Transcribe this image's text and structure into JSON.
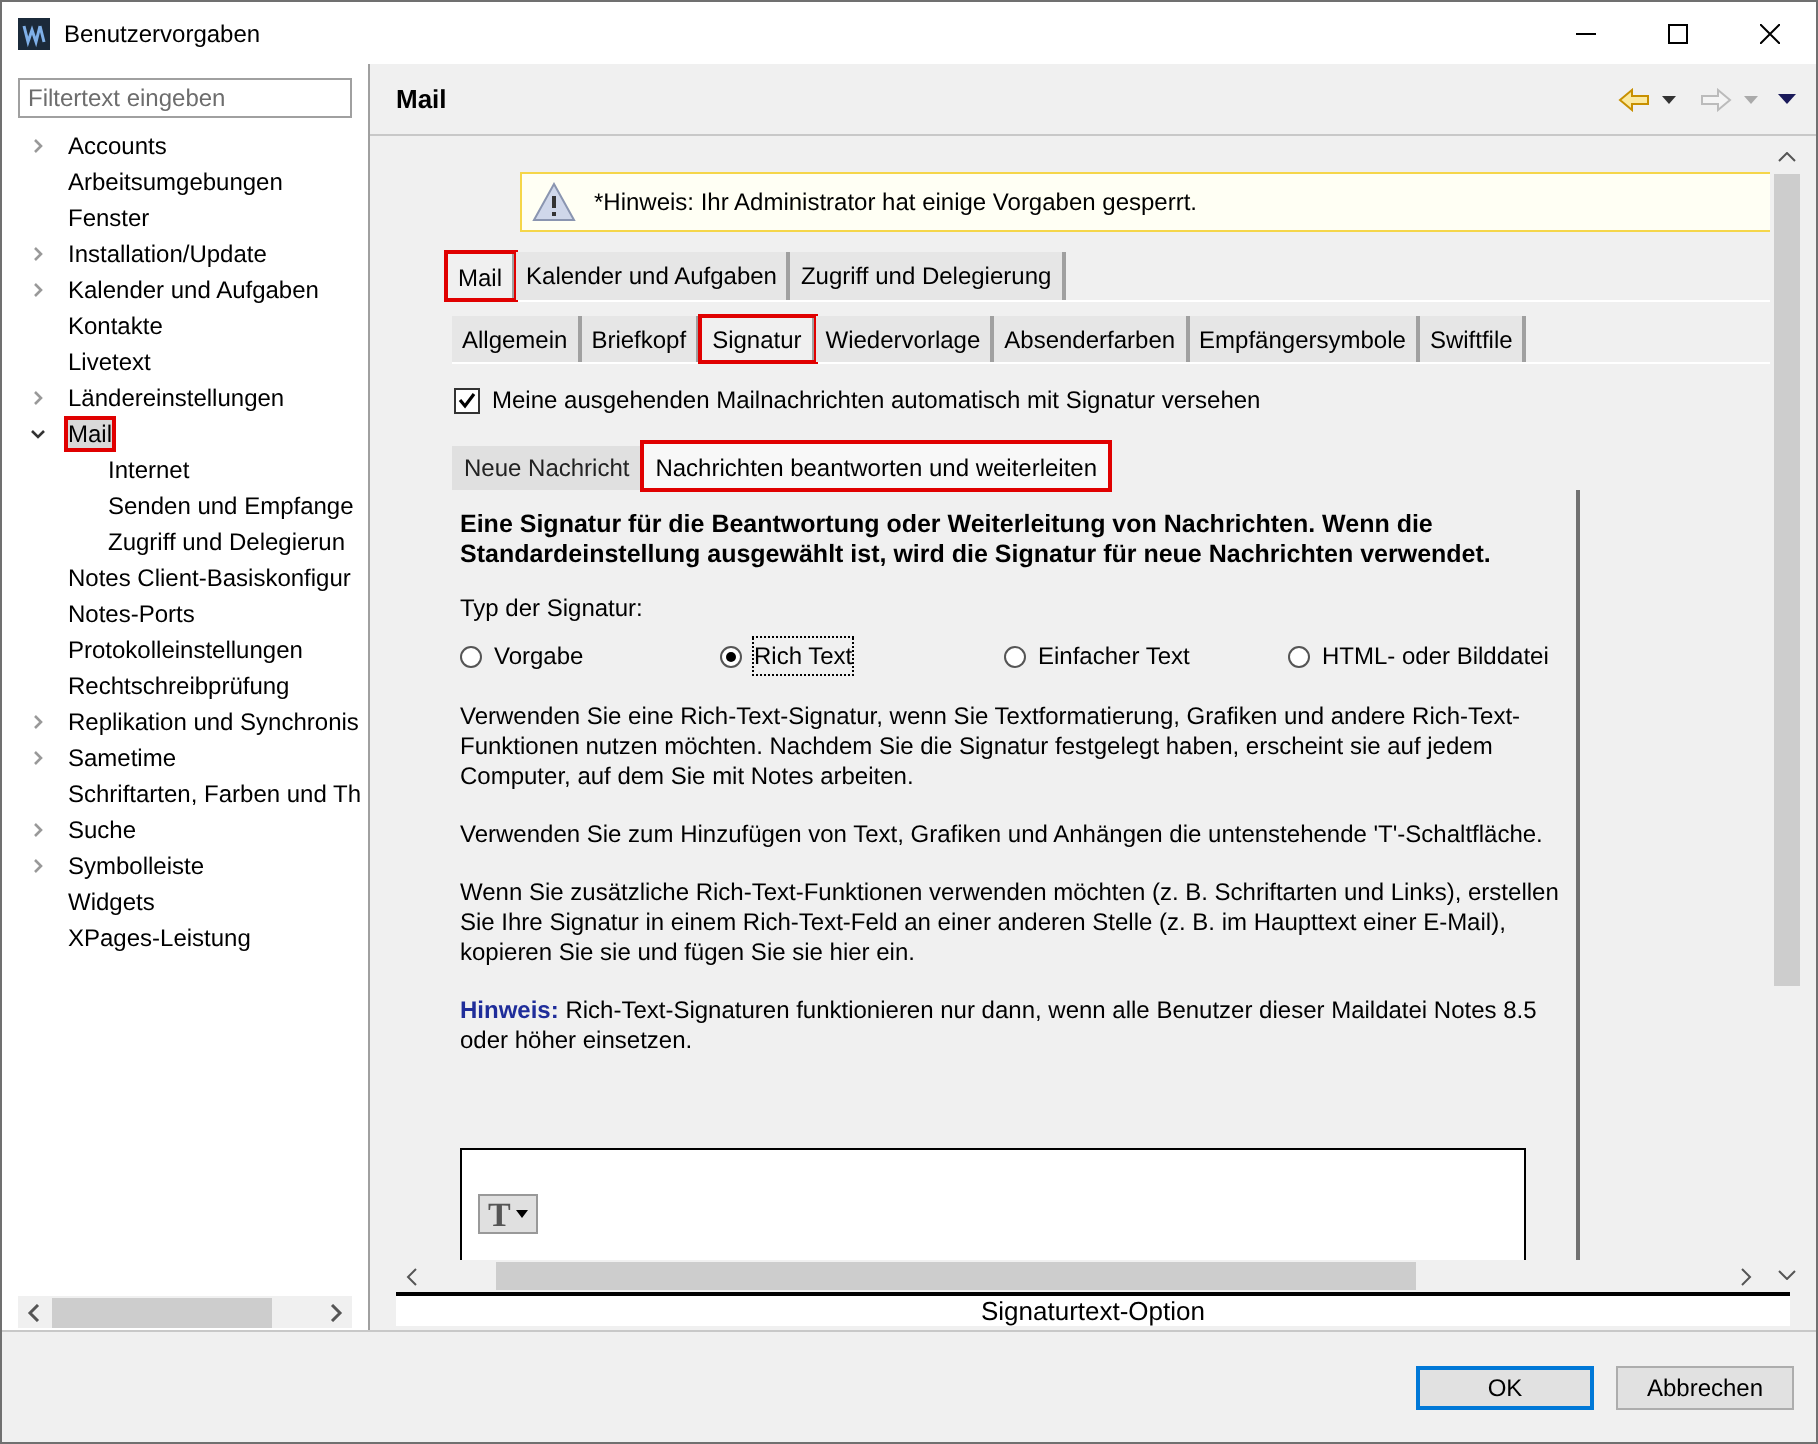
{
  "window": {
    "title": "Benutzervorgaben"
  },
  "filter": {
    "placeholder": "Filtertext eingeben"
  },
  "tree": [
    {
      "label": "Accounts",
      "expanded": false,
      "selected": false,
      "annotated": false
    },
    {
      "label": "Arbeitsumgebungen",
      "selected": false,
      "annotated": false
    },
    {
      "label": "Fenster",
      "selected": false,
      "annotated": false
    },
    {
      "label": "Installation/Update",
      "expanded": false,
      "selected": false,
      "annotated": false
    },
    {
      "label": "Kalender und Aufgaben",
      "expanded": false,
      "selected": false,
      "annotated": false
    },
    {
      "label": "Kontakte",
      "selected": false,
      "annotated": false
    },
    {
      "label": "Livetext",
      "selected": false,
      "annotated": false
    },
    {
      "label": "Ländereinstellungen",
      "expanded": false,
      "selected": false,
      "annotated": false
    },
    {
      "label": "Mail",
      "expanded": true,
      "selected": true,
      "annotated": true,
      "children": [
        {
          "label": "Internet",
          "selected": false,
          "annotated": false
        },
        {
          "label": "Senden und Empfange",
          "selected": false,
          "annotated": false
        },
        {
          "label": "Zugriff und Delegierun",
          "selected": false,
          "annotated": false
        }
      ]
    },
    {
      "label": "Notes Client-Basiskonfigur",
      "selected": false,
      "annotated": false
    },
    {
      "label": "Notes-Ports",
      "selected": false,
      "annotated": false
    },
    {
      "label": "Protokolleinstellungen",
      "selected": false,
      "annotated": false
    },
    {
      "label": "Rechtschreibprüfung",
      "selected": false,
      "annotated": false
    },
    {
      "label": "Replikation und Synchronis",
      "expanded": false,
      "selected": false,
      "annotated": false
    },
    {
      "label": "Sametime",
      "expanded": false,
      "selected": false,
      "annotated": false
    },
    {
      "label": "Schriftarten, Farben und Th",
      "selected": false,
      "annotated": false
    },
    {
      "label": "Suche",
      "expanded": false,
      "selected": false,
      "annotated": false
    },
    {
      "label": "Symbolleiste",
      "expanded": false,
      "selected": false,
      "annotated": false
    },
    {
      "label": "Widgets",
      "selected": false,
      "annotated": false
    },
    {
      "label": "XPages-Leistung",
      "selected": false,
      "annotated": false
    }
  ],
  "page": {
    "title": "Mail",
    "notice": "*Hinweis: Ihr Administrator hat einige Vorgaben gesperrt.",
    "tabs": [
      {
        "label": "Mail",
        "selected": true,
        "annotated": true
      },
      {
        "label": "Kalender und Aufgaben",
        "selected": false,
        "annotated": false
      },
      {
        "label": "Zugriff und Delegierung",
        "selected": false,
        "annotated": false
      }
    ],
    "subtabs": [
      {
        "label": "Allgemein",
        "selected": false,
        "annotated": false
      },
      {
        "label": "Briefkopf",
        "selected": false,
        "annotated": false
      },
      {
        "label": "Signatur",
        "selected": true,
        "annotated": true
      },
      {
        "label": "Wiedervorlage",
        "selected": false,
        "annotated": false
      },
      {
        "label": "Absenderfarben",
        "selected": false,
        "annotated": false
      },
      {
        "label": "Empfängersymbole",
        "selected": false,
        "annotated": false
      },
      {
        "label": "Swiftfile",
        "selected": false,
        "annotated": false
      }
    ],
    "auto_signature": {
      "label": "Meine ausgehenden Mailnachrichten automatisch mit Signatur versehen",
      "checked": true
    },
    "inner_tabs": [
      {
        "label": "Neue Nachricht",
        "selected": false,
        "annotated": false
      },
      {
        "label": "Nachrichten beantworten und weiterleiten",
        "selected": true,
        "annotated": true
      }
    ],
    "heading": "Eine Signatur für die Beantwortung oder Weiterleitung von Nachrichten. Wenn die Standardeinstellung ausgewählt ist, wird die Signatur für neue Nachrichten verwendet.",
    "type_label": "Typ der Signatur:",
    "types": [
      {
        "label": "Vorgabe",
        "selected": false
      },
      {
        "label": "Rich Text",
        "selected": true
      },
      {
        "label": "Einfacher Text",
        "selected": false
      },
      {
        "label": "HTML- oder Bilddatei",
        "selected": false
      }
    ],
    "paragraphs": [
      "Verwenden Sie eine Rich-Text-Signatur, wenn Sie Textformatierung, Grafiken und andere Rich-Text-Funktionen nutzen möchten.   Nachdem Sie die Signatur festgelegt haben, erscheint sie auf jedem Computer, auf dem Sie mit Notes arbeiten.",
      "Verwenden Sie zum Hinzufügen von Text, Grafiken und Anhängen die untenstehende 'T'-Schaltfläche.",
      "Wenn Sie zusätzliche Rich-Text-Funktionen verwenden möchten (z. B. Schriftarten und Links), erstellen Sie Ihre Signatur in einem Rich-Text-Feld an einer anderen Stelle (z. B. im Haupttext einer E-Mail), kopieren Sie sie und fügen Sie sie hier ein."
    ],
    "note_label": "Hinweis:",
    "note_text": "Rich-Text-Signaturen funktionieren nur dann, wenn alle Benutzer dieser Maildatei Notes 8.5 oder höher einsetzen.",
    "editor_button": "T",
    "caption": "Signaturtext-Option"
  },
  "buttons": [
    {
      "label": "OK",
      "kind": "default"
    },
    {
      "label": "Abbrechen",
      "kind": "normal"
    }
  ]
}
